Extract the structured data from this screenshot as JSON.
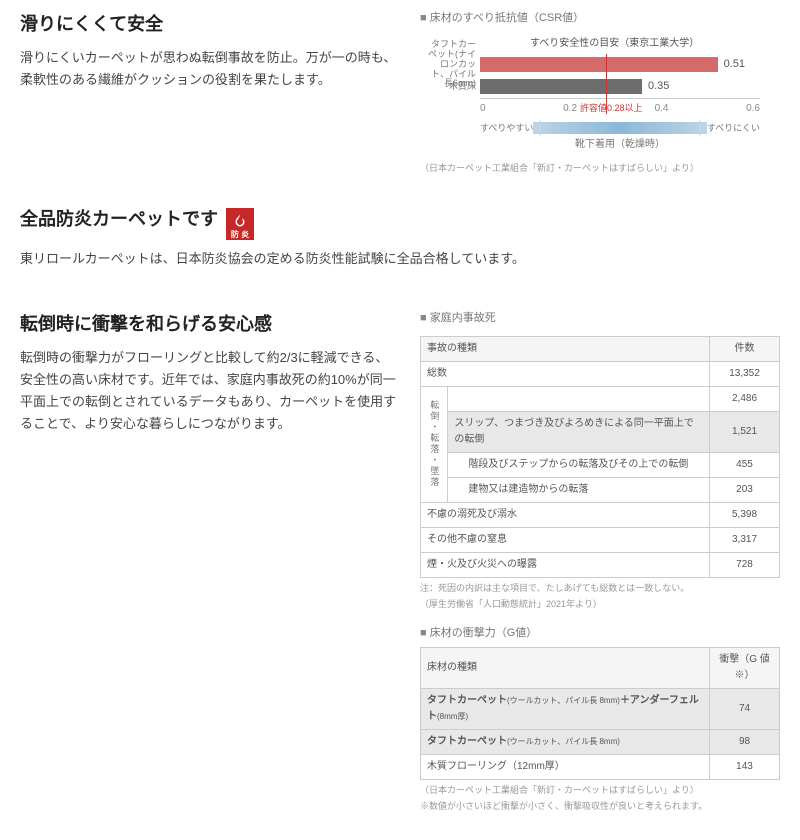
{
  "s1": {
    "title": "滑りにくくて安全",
    "desc": "滑りにくいカーペットが思わぬ転倒事故を防止。万が一の時も、柔軟性のある繊維がクッションの役割を果たします。",
    "chartTitle": "床材のすべり抵抗値（CSR値）",
    "safetyLine": "すべり安全性の目安（東京工業大学）",
    "thresholdTxt": "許容値0.28以上",
    "arrowLeft": "すべりやすい",
    "arrowRight": "すべりにくい",
    "arrowCaption": "靴下着用（乾燥時）",
    "source": "（日本カーペット工業組合「新訂・カーペットはすばらしい」より）"
  },
  "chart_data": {
    "type": "bar",
    "categories": [
      "タフトカーペット(ナイロンカット、パイル長6mm)",
      "木質床"
    ],
    "values": [
      0.51,
      0.35
    ],
    "xlabel": "すべり抵抗値（CSR値）",
    "xlim": [
      0,
      0.6
    ],
    "ticks": [
      0,
      0.2,
      0.4,
      0.6
    ],
    "threshold": 0.28,
    "colors": [
      "#d46a6a",
      "#6d6d6d"
    ]
  },
  "s2": {
    "title": "全品防炎カーペットです",
    "iconTxt": "防 炎",
    "desc": "東リロールカーペットは、日本防炎協会の定める防炎性能試験に全品合格しています。"
  },
  "s3": {
    "title": "転倒時に衝撃を和らげる安心感",
    "desc": "転倒時の衝撃力がフローリングと比較して約2/3に軽減できる、安全性の高い床材です。近年では、家庭内事故死の約10%が同一平面上での転倒とされているデータもあり、カーペットを使用することで、より安心な暮らしにつながります。",
    "t1Title": "家庭内事故死",
    "t1h1": "事故の種類",
    "t1h2": "件数",
    "rotLabel": "転倒・転落・墜落",
    "r1a": "総数",
    "r1b": "13,352",
    "r2b": "2,486",
    "r3a": "スリップ、つまづき及びよろめきによる同一平面上での転倒",
    "r3b": "1,521",
    "r4a": "階段及びステップからの転落及びその上での転倒",
    "r4b": "455",
    "r5a": "建物又は建造物からの転落",
    "r5b": "203",
    "r6a": "不慮の溺死及び溺水",
    "r6b": "5,398",
    "r7a": "その他不慮の窒息",
    "r7b": "3,317",
    "r8a": "煙・火及び火災への曝露",
    "r8b": "728",
    "t1note1": "注：死因の内訳は主な項目で、たしあげても総数とは一致しない。",
    "t1note2": "（厚生労働省「人口動態統計」2021年より）",
    "t2Title": "床材の衝撃力（G値）",
    "t2h1": "床材の種類",
    "t2h2": "衝撃（G 値※）",
    "t2r1a": "タフトカーペット",
    "t2r1s": "(ウールカット、パイル長 8mm)",
    "t2r1s2": "＋アンダーフェルト",
    "t2r1s3": "(8mm厚)",
    "t2r1b": "74",
    "t2r2a": "タフトカーペット",
    "t2r2s": "(ウールカット、パイル長 8mm)",
    "t2r2b": "98",
    "t2r3a": "木質フローリング（12mm厚）",
    "t2r3b": "143",
    "t2note1": "（日本カーペット工業組合「新訂・カーペットはすばらしい」より）",
    "t2note2": "※数値が小さいほど衝撃が小さく、衝撃吸収性が良いと考えられます。"
  }
}
